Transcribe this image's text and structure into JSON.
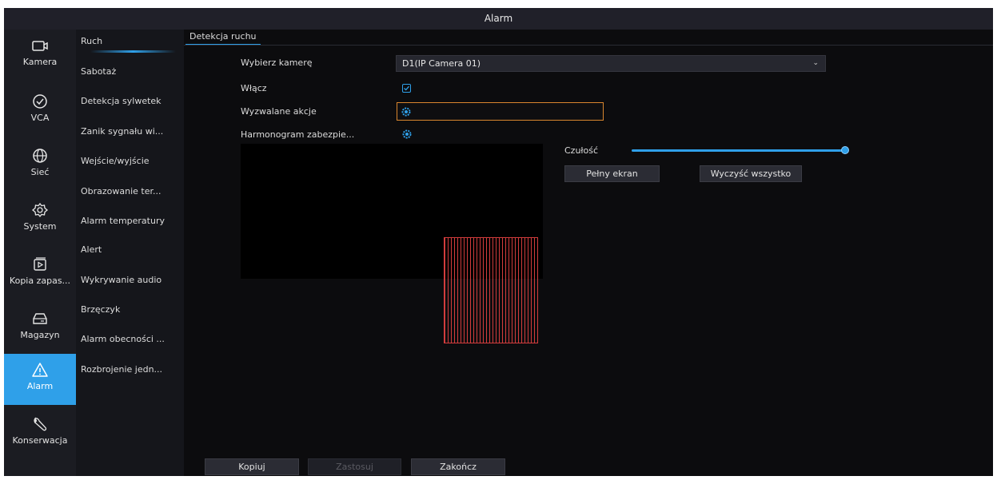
{
  "window": {
    "title": "Alarm"
  },
  "nav": {
    "items": [
      {
        "label": "Kamera",
        "icon": "camera-icon"
      },
      {
        "label": "VCA",
        "icon": "vca-icon"
      },
      {
        "label": "Sieć",
        "icon": "globe-icon"
      },
      {
        "label": "System",
        "icon": "gear-icon"
      },
      {
        "label": "Kopia zapas...",
        "icon": "backup-icon"
      },
      {
        "label": "Magazyn",
        "icon": "storage-icon"
      },
      {
        "label": "Alarm",
        "icon": "alarm-warning-icon"
      },
      {
        "label": "Konserwacja",
        "icon": "wrench-icon"
      }
    ],
    "active": "Alarm"
  },
  "submenu": {
    "items": [
      "Ruch",
      "Sabotaż",
      "Detekcja sylwetek",
      "Zanik sygnału wi...",
      "Wejście/wyjście",
      "Obrazowanie ter...",
      "Alarm temperatury",
      "Alert",
      "Wykrywanie audio",
      "Brzęczyk",
      "Alarm obecności ...",
      "Rozbrojenie jedn..."
    ],
    "active": "Ruch"
  },
  "tab": {
    "label": "Detekcja ruchu"
  },
  "form": {
    "camera_label": "Wybierz kamerę",
    "camera_value": "D1(IP Camera 01)",
    "enable_label": "Włącz",
    "enable_checked": true,
    "actions_label": "Wyzwalane akcje",
    "schedule_label": "Harmonogram zabezpie..."
  },
  "sensitivity": {
    "label": "Czułość",
    "level": 1.0
  },
  "buttons": {
    "fullscreen": "Pełny ekran",
    "clear_all": "Wyczyść wszystko",
    "copy": "Kopiuj",
    "apply": "Zastosuj",
    "finish": "Zakończ"
  },
  "colors": {
    "accent": "#2fa0e9",
    "focus_border": "#d9862e",
    "motion_grid": "#d23c3c"
  }
}
